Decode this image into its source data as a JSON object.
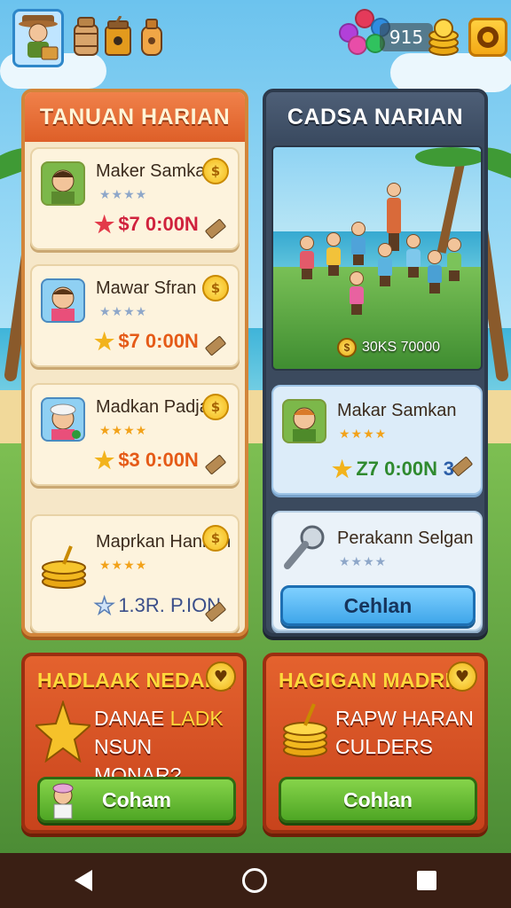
{
  "topbar": {
    "gem_count": "915",
    "icons": [
      "player-avatar-icon",
      "barrel-icon",
      "honey-jar-icon",
      "potion-bottle-icon",
      "gems-icon",
      "coin-stack-icon",
      "menu-icon"
    ]
  },
  "left_panel": {
    "title": "TANUAN HARIAN",
    "tasks": [
      {
        "name": "Maker Samkan",
        "stars": "★★★★",
        "reward": "$7 0:00N"
      },
      {
        "name": "Mawar Sfran",
        "stars": "★★★★",
        "reward": "$7 0:00N"
      },
      {
        "name": "Madkan Padjan",
        "stars": "★★★★",
        "reward": "$3 0:00N"
      },
      {
        "name": "Maprkan Hankan",
        "stars": "★★★★",
        "reward": "1.3R. P.ION"
      }
    ],
    "coin_symbol": "$"
  },
  "right_panel": {
    "title": "CADSA NARIAN",
    "scene_prize": "30KS 70000",
    "card1": {
      "name": "Makar Samkan",
      "stars": "★★★★",
      "reward": "Z7 0:00N",
      "extra": "3"
    },
    "card2": {
      "name": "Perakann Selgan",
      "stars": "★★★★",
      "button": "Cehlan"
    }
  },
  "promo_left": {
    "title": "HADLAAK NEDAHI!",
    "line1_a": "DANAE ",
    "line1_b": "LADK",
    "line2": "NSUN MONAR?",
    "button": "Coham"
  },
  "promo_right": {
    "title": "HAGIGAN MADRIK",
    "line1": "RAPW HARAN",
    "line2": "CULDERS",
    "button": "Cohlan"
  },
  "colors": {
    "accent_orange": "#de5f28",
    "panel_dark": "#3b4a5e",
    "button_green": "#4ea624",
    "button_blue": "#3fa6ea"
  }
}
